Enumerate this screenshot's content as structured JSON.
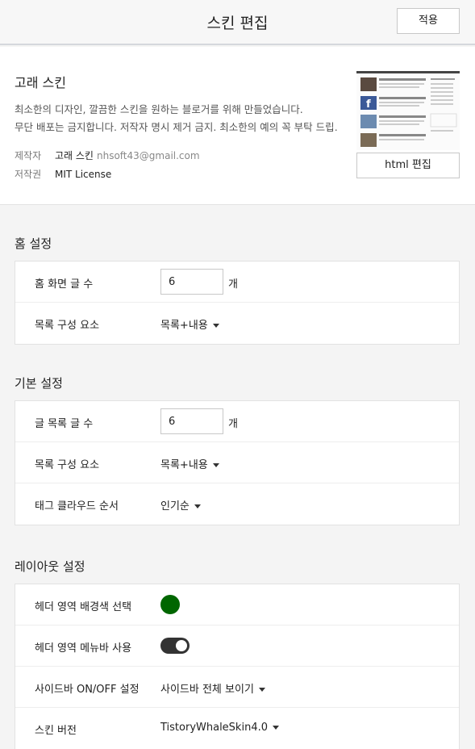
{
  "header": {
    "title": "스킨 편집",
    "apply_label": "적용"
  },
  "skin": {
    "name": "고래 스킨",
    "desc_line1": "최소한의 디자인, 깔끔한 스킨을 원하는 블로거를 위해 만들었습니다.",
    "desc_line2": "무단 배포는 금지합니다. 저작자 명시 제거 금지. 최소한의 예의 꼭 부탁 드립…",
    "author_key": "제작자",
    "author_name": "고래 스킨",
    "author_email": "nhsoft43@gmail.com",
    "license_key": "저작권",
    "license_value": "MIT License",
    "html_edit_label": "html 편집"
  },
  "home": {
    "title": "홈 설정",
    "post_count_label": "홈 화면 글 수",
    "post_count_value": "6",
    "post_count_unit": "개",
    "list_component_label": "목록 구성 요소",
    "list_component_value": "목록+내용"
  },
  "basic": {
    "title": "기본 설정",
    "post_count_label": "글 목록 글 수",
    "post_count_value": "6",
    "post_count_unit": "개",
    "list_component_label": "목록 구성 요소",
    "list_component_value": "목록+내용",
    "tag_cloud_label": "태그 클라우드 순서",
    "tag_cloud_value": "인기순"
  },
  "layout": {
    "title": "레이아웃 설정",
    "header_bg_label": "헤더 영역 배경색 선택",
    "header_bg_color": "#006600",
    "header_menubar_label": "헤더 영역 메뉴바 사용",
    "header_menubar_on": true,
    "sidebar_label": "사이드바 ON/OFF 설정",
    "sidebar_value": "사이드바 전체 보이기",
    "skin_version_label": "스킨 버전",
    "skin_version_value": "TistoryWhaleSkin4.0"
  }
}
